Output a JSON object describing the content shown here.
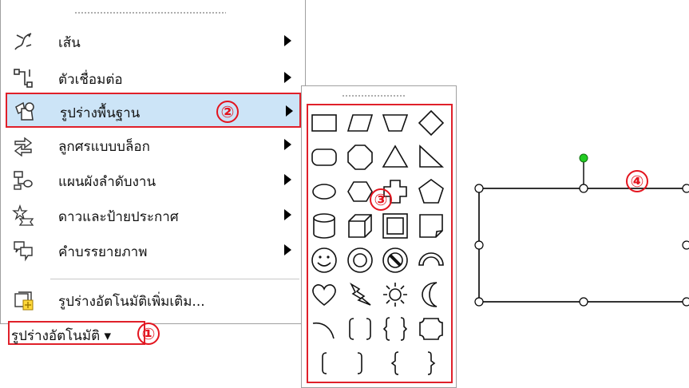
{
  "menu": {
    "items": [
      {
        "label": "เส้น",
        "icon": "lines-icon",
        "has_submenu": true
      },
      {
        "label": "ตัวเชื่อมต่อ",
        "icon": "connectors-icon",
        "has_submenu": true
      },
      {
        "label": "รูปร่างพื้นฐาน",
        "icon": "basic-shapes-icon",
        "has_submenu": true,
        "highlighted": true
      },
      {
        "label": "ลูกศรแบบบล็อก",
        "icon": "block-arrows-icon",
        "has_submenu": true
      },
      {
        "label": "แผนผังลำดับงาน",
        "icon": "flowchart-icon",
        "has_submenu": true
      },
      {
        "label": "ดาวและป้ายประกาศ",
        "icon": "stars-banners-icon",
        "has_submenu": true
      },
      {
        "label": "คำบรรยายภาพ",
        "icon": "callouts-icon",
        "has_submenu": true
      },
      {
        "label": "รูปร่างอัตโนมัติเพิ่มเติม...",
        "icon": "more-autoshapes-icon",
        "has_submenu": false
      }
    ]
  },
  "toolbar": {
    "autoshapes_label": "รูปร่างอัตโนมัติ ▾"
  },
  "callouts": [
    "①",
    "②",
    "③",
    "④"
  ],
  "palette": {
    "shapes": [
      "rectangle",
      "parallelogram",
      "trapezoid",
      "diamond",
      "rounded-rectangle",
      "octagon",
      "triangle",
      "right-triangle",
      "oval",
      "hexagon",
      "cross",
      "pentagon",
      "can",
      "cube",
      "bevel",
      "folded-corner",
      "smiley-face",
      "donut",
      "no-symbol",
      "block-arc",
      "heart",
      "lightning-bolt",
      "sun",
      "moon",
      "arc",
      "double-bracket",
      "double-brace",
      "plaque",
      "left-bracket",
      "right-bracket",
      "left-brace",
      "right-brace"
    ]
  },
  "colors": {
    "highlight_bg": "#cce4f7",
    "annotation_red": "#e0202a",
    "rotation_handle": "#22cc22"
  }
}
